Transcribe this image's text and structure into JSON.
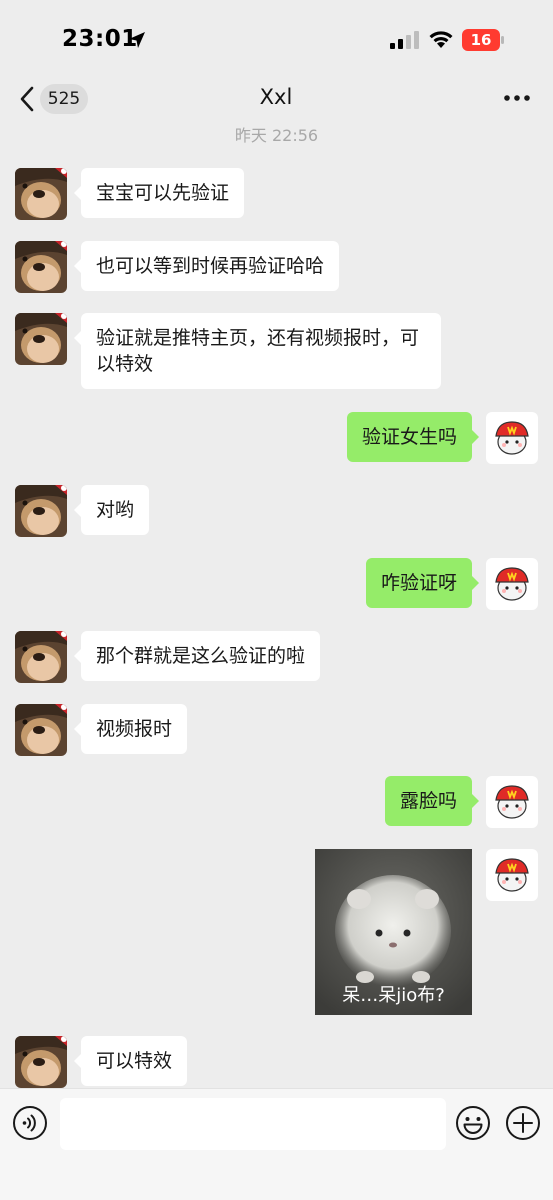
{
  "status_bar": {
    "time": "23:01",
    "battery": "16",
    "icons": [
      "location-arrow-icon",
      "signal-icon",
      "wifi-icon",
      "battery-icon"
    ],
    "battery_color": "#ff3b30"
  },
  "nav": {
    "back_count": "525",
    "title": "Xxl",
    "icons": [
      "back-chevron-icon",
      "more-icon"
    ]
  },
  "timestamp": "昨天 22:56",
  "colors": {
    "background": "#ededed",
    "incoming_bubble": "#ffffff",
    "outgoing_bubble": "#95ec69"
  },
  "messages": [
    {
      "side": "incoming",
      "text": "宝宝可以先验证"
    },
    {
      "side": "incoming",
      "text": "也可以等到时候再验证哈哈"
    },
    {
      "side": "incoming",
      "text": "验证就是推特主页，还有视频报时，可以特效"
    },
    {
      "side": "outgoing",
      "text": "验证女生吗"
    },
    {
      "side": "incoming",
      "text": "对哟"
    },
    {
      "side": "outgoing",
      "text": "咋验证呀"
    },
    {
      "side": "incoming",
      "text": "那个群就是这么验证的啦"
    },
    {
      "side": "incoming",
      "text": "视频报时"
    },
    {
      "side": "outgoing",
      "text": "露脸吗"
    },
    {
      "side": "outgoing",
      "type": "sticker",
      "caption": "呆…呆jio布?"
    },
    {
      "side": "incoming",
      "text": "可以特效"
    }
  ],
  "input_bar": {
    "icons": [
      "voice-icon",
      "emoji-icon",
      "plus-icon"
    ],
    "placeholder": ""
  }
}
